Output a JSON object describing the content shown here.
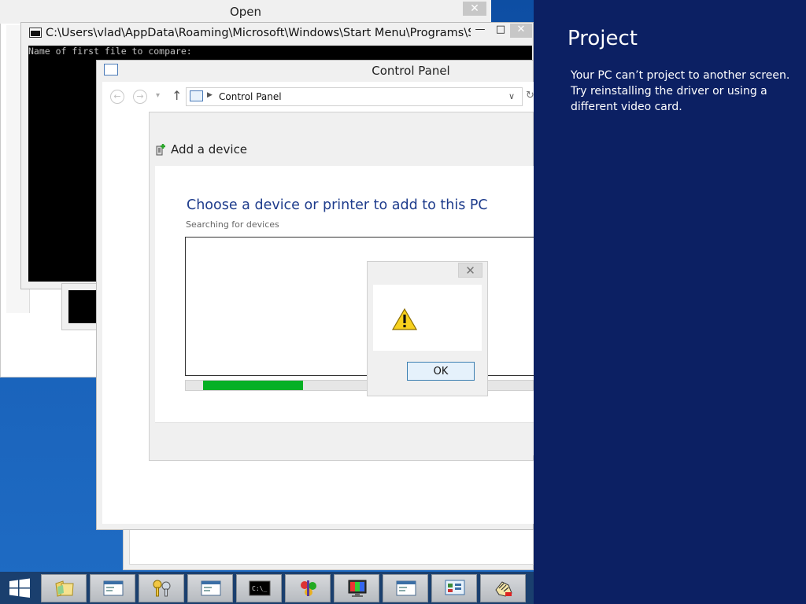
{
  "open_dialog": {
    "title": "Open",
    "close_label": "✕"
  },
  "console": {
    "title": "C:\\Users\\vlad\\AppData\\Roaming\\Microsoft\\Windows\\Start Menu\\Programs\\St...",
    "output": "Name of first file to compare:",
    "minimize_label": "—",
    "maximize_label": "□",
    "close_label": "✕"
  },
  "control_panel": {
    "title": "Control Panel",
    "address": "Control Panel",
    "back_label": "←",
    "forward_label": "→",
    "recent_label": "▾",
    "up_label": "↑",
    "breadcrumb_sep": "▶",
    "dropdown_label": "∨",
    "refresh_label": "↻"
  },
  "add_device": {
    "header": "Add a device",
    "heading": "Choose a device or printer to add to this PC",
    "status": "Searching for devices",
    "progress": 0.38
  },
  "message_box": {
    "close_label": "✕",
    "ok_label": "OK"
  },
  "project_panel": {
    "title": "Project",
    "message": "Your PC can’t project to another screen. Try reinstalling the driver or using a different video card."
  },
  "taskbar": {
    "items": [
      {
        "name": "taskbar-explorer",
        "icon": "folder-icon"
      },
      {
        "name": "taskbar-window-1",
        "icon": "window-icon"
      },
      {
        "name": "taskbar-keys",
        "icon": "keys-icon"
      },
      {
        "name": "taskbar-window-2",
        "icon": "window-icon"
      },
      {
        "name": "taskbar-cmd",
        "icon": "cmd-icon"
      },
      {
        "name": "taskbar-app-colorful",
        "icon": "app-icon"
      },
      {
        "name": "taskbar-display",
        "icon": "monitor-icon"
      },
      {
        "name": "taskbar-window-3",
        "icon": "window-icon"
      },
      {
        "name": "taskbar-control-panel",
        "icon": "control-panel-icon"
      },
      {
        "name": "taskbar-app-hand",
        "icon": "hand-icon"
      }
    ]
  },
  "colors": {
    "project_panel_bg": "#0c2063",
    "progress_green": "#06b025",
    "heading_blue": "#1e3c8c"
  }
}
